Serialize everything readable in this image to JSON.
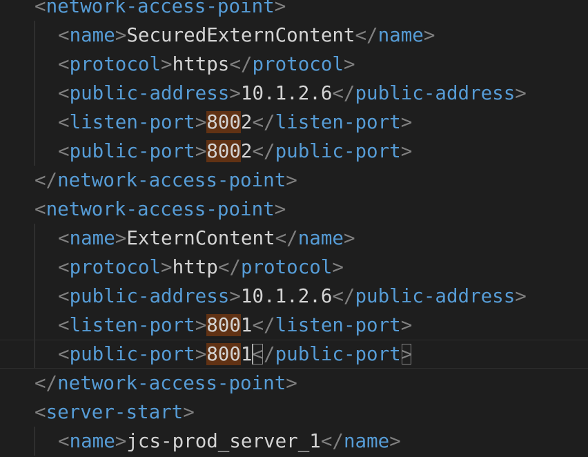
{
  "editor": {
    "lines": [
      {
        "indent": 0,
        "kind": "open",
        "tag": "network-access-point"
      },
      {
        "indent": 1,
        "kind": "elem",
        "tag": "name",
        "value": "SecuredExternContent"
      },
      {
        "indent": 1,
        "kind": "elem",
        "tag": "protocol",
        "value": "https"
      },
      {
        "indent": 1,
        "kind": "elem",
        "tag": "public-address",
        "value": "10.1.2.6"
      },
      {
        "indent": 1,
        "kind": "elem",
        "tag": "listen-port",
        "value": "8002",
        "highlight": "800"
      },
      {
        "indent": 1,
        "kind": "elem",
        "tag": "public-port",
        "value": "8002",
        "highlight": "800"
      },
      {
        "indent": 0,
        "kind": "close",
        "tag": "network-access-point"
      },
      {
        "indent": 0,
        "kind": "open",
        "tag": "network-access-point"
      },
      {
        "indent": 1,
        "kind": "elem",
        "tag": "name",
        "value": "ExternContent"
      },
      {
        "indent": 1,
        "kind": "elem",
        "tag": "protocol",
        "value": "http"
      },
      {
        "indent": 1,
        "kind": "elem",
        "tag": "public-address",
        "value": "10.1.2.6"
      },
      {
        "indent": 1,
        "kind": "elem",
        "tag": "listen-port",
        "value": "8001",
        "highlight": "800"
      },
      {
        "indent": 1,
        "kind": "elem",
        "tag": "public-port",
        "value": "8001",
        "highlight": "800",
        "current": true,
        "bracket_match": true
      },
      {
        "indent": 0,
        "kind": "close",
        "tag": "network-access-point"
      },
      {
        "indent": 0,
        "kind": "open",
        "tag": "server-start"
      },
      {
        "indent": 1,
        "kind": "elem",
        "tag": "name",
        "value": "jcs-prod_server_1"
      }
    ]
  },
  "theme": {
    "background": "#1e1e1e",
    "bracket_color": "#808080",
    "tag_name_color": "#569cd6",
    "text_color": "#d4d4d4",
    "find_highlight": "#613214"
  }
}
